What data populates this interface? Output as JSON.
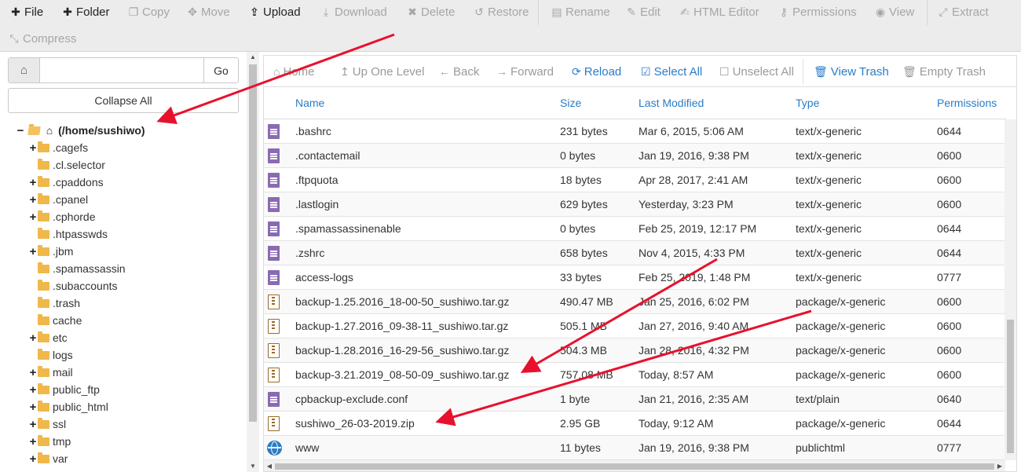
{
  "toolbar": {
    "buttons": [
      {
        "label": "File",
        "icon": "plus-icon",
        "enabled": true
      },
      {
        "label": "Folder",
        "icon": "plus-icon",
        "enabled": true
      },
      {
        "label": "Copy",
        "icon": "copy-icon",
        "enabled": false
      },
      {
        "label": "Move",
        "icon": "move-arrows-icon",
        "enabled": false
      },
      {
        "label": "Upload",
        "icon": "upload-icon",
        "enabled": true
      },
      {
        "label": "Download",
        "icon": "download-icon",
        "enabled": false
      },
      {
        "label": "Delete",
        "icon": "x-icon",
        "enabled": false
      },
      {
        "label": "Restore",
        "icon": "undo-icon",
        "enabled": false
      },
      {
        "label": "Rename",
        "icon": "file-icon",
        "enabled": false
      },
      {
        "label": "Edit",
        "icon": "pencil-icon",
        "enabled": false
      },
      {
        "label": "HTML Editor",
        "icon": "edit-square-icon",
        "enabled": false
      },
      {
        "label": "Permissions",
        "icon": "key-icon",
        "enabled": false
      },
      {
        "label": "View",
        "icon": "eye-icon",
        "enabled": false
      },
      {
        "label": "Extract",
        "icon": "expand-icon",
        "enabled": false
      },
      {
        "label": "Compress",
        "icon": "compress-icon",
        "enabled": false
      }
    ]
  },
  "left": {
    "path_value": "",
    "go_label": "Go",
    "collapse_label": "Collapse All",
    "root_label": "(/home/sushiwo)",
    "tree": [
      {
        "label": ".cagefs",
        "expandable": true
      },
      {
        "label": ".cl.selector",
        "expandable": false
      },
      {
        "label": ".cpaddons",
        "expandable": true
      },
      {
        "label": ".cpanel",
        "expandable": true
      },
      {
        "label": ".cphorde",
        "expandable": true
      },
      {
        "label": ".htpasswds",
        "expandable": false
      },
      {
        "label": ".jbm",
        "expandable": true
      },
      {
        "label": ".spamassassin",
        "expandable": false
      },
      {
        "label": ".subaccounts",
        "expandable": false
      },
      {
        "label": ".trash",
        "expandable": false
      },
      {
        "label": "cache",
        "expandable": false
      },
      {
        "label": "etc",
        "expandable": true
      },
      {
        "label": "logs",
        "expandable": false
      },
      {
        "label": "mail",
        "expandable": true
      },
      {
        "label": "public_ftp",
        "expandable": true
      },
      {
        "label": "public_html",
        "expandable": true
      },
      {
        "label": "ssl",
        "expandable": true
      },
      {
        "label": "tmp",
        "expandable": true
      },
      {
        "label": "var",
        "expandable": true
      }
    ]
  },
  "nav": {
    "buttons": [
      {
        "label": "Home",
        "icon": "home-icon",
        "active": false
      },
      {
        "label": "Up One Level",
        "icon": "level-up-icon",
        "active": false
      },
      {
        "label": "Back",
        "icon": "arrow-left-icon",
        "active": false
      },
      {
        "label": "Forward",
        "icon": "arrow-right-icon",
        "active": false
      },
      {
        "label": "Reload",
        "icon": "refresh-icon",
        "active": true
      },
      {
        "label": "Select All",
        "icon": "checkbox-checked-icon",
        "active": true
      },
      {
        "label": "Unselect All",
        "icon": "checkbox-empty-icon",
        "active": false
      },
      {
        "label": "View Trash",
        "icon": "trash-icon",
        "active": true
      },
      {
        "label": "Empty Trash",
        "icon": "trash-icon",
        "active": false
      }
    ]
  },
  "table": {
    "headers": [
      "Name",
      "Size",
      "Last Modified",
      "Type",
      "Permissions"
    ],
    "rows": [
      {
        "name": ".bashrc",
        "size": "231 bytes",
        "modified": "Mar 6, 2015, 5:06 AM",
        "type": "text/x-generic",
        "perms": "0644",
        "icon": "text-file-icon"
      },
      {
        "name": ".contactemail",
        "size": "0 bytes",
        "modified": "Jan 19, 2016, 9:38 PM",
        "type": "text/x-generic",
        "perms": "0600",
        "icon": "text-file-icon"
      },
      {
        "name": ".ftpquota",
        "size": "18 bytes",
        "modified": "Apr 28, 2017, 2:41 AM",
        "type": "text/x-generic",
        "perms": "0600",
        "icon": "text-file-icon"
      },
      {
        "name": ".lastlogin",
        "size": "629 bytes",
        "modified": "Yesterday, 3:23 PM",
        "type": "text/x-generic",
        "perms": "0600",
        "icon": "text-file-icon"
      },
      {
        "name": ".spamassassinenable",
        "size": "0 bytes",
        "modified": "Feb 25, 2019, 12:17 PM",
        "type": "text/x-generic",
        "perms": "0644",
        "icon": "text-file-icon"
      },
      {
        "name": ".zshrc",
        "size": "658 bytes",
        "modified": "Nov 4, 2015, 4:33 PM",
        "type": "text/x-generic",
        "perms": "0644",
        "icon": "text-file-icon"
      },
      {
        "name": "access-logs",
        "size": "33 bytes",
        "modified": "Feb 25, 2019, 1:48 PM",
        "type": "text/x-generic",
        "perms": "0777",
        "icon": "text-file-icon"
      },
      {
        "name": "backup-1.25.2016_18-00-50_sushiwo.tar.gz",
        "size": "490.47 MB",
        "modified": "Jan 25, 2016, 6:02 PM",
        "type": "package/x-generic",
        "perms": "0600",
        "icon": "archive-file-icon"
      },
      {
        "name": "backup-1.27.2016_09-38-11_sushiwo.tar.gz",
        "size": "505.1 MB",
        "modified": "Jan 27, 2016, 9:40 AM",
        "type": "package/x-generic",
        "perms": "0600",
        "icon": "archive-file-icon"
      },
      {
        "name": "backup-1.28.2016_16-29-56_sushiwo.tar.gz",
        "size": "504.3 MB",
        "modified": "Jan 28, 2016, 4:32 PM",
        "type": "package/x-generic",
        "perms": "0600",
        "icon": "archive-file-icon"
      },
      {
        "name": "backup-3.21.2019_08-50-09_sushiwo.tar.gz",
        "size": "757.08 MB",
        "modified": "Today, 8:57 AM",
        "type": "package/x-generic",
        "perms": "0600",
        "icon": "archive-file-icon"
      },
      {
        "name": "cpbackup-exclude.conf",
        "size": "1 byte",
        "modified": "Jan 21, 2016, 2:35 AM",
        "type": "text/plain",
        "perms": "0640",
        "icon": "text-file-icon"
      },
      {
        "name": "sushiwo_26-03-2019.zip",
        "size": "2.95 GB",
        "modified": "Today, 9:12 AM",
        "type": "package/x-generic",
        "perms": "0644",
        "icon": "archive-file-icon"
      },
      {
        "name": "www",
        "size": "11 bytes",
        "modified": "Jan 19, 2016, 9:38 PM",
        "type": "publichtml",
        "perms": "0777",
        "icon": "globe-icon"
      }
    ]
  },
  "colors": {
    "link_blue": "#2a7cc7",
    "annotation_red": "#e8112d",
    "folder_yellow": "#f0b74a",
    "text_file_purple": "#8a6ab3",
    "archive_brown": "#9a6a27"
  }
}
